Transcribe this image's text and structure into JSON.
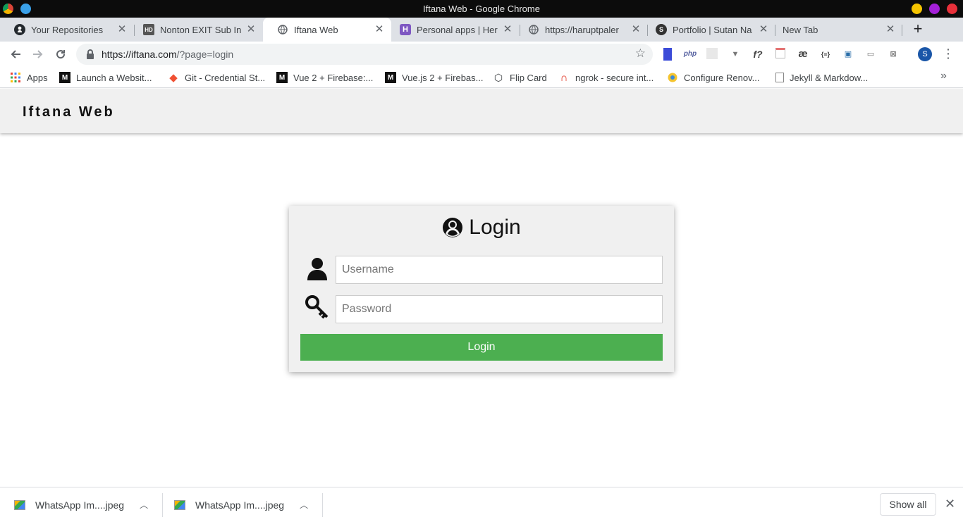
{
  "window": {
    "title": "Iftana Web - Google Chrome"
  },
  "tabs": [
    {
      "label": "Your Repositories",
      "icon": "github-icon"
    },
    {
      "label": "Nonton EXIT Sub In",
      "icon": "hd-icon"
    },
    {
      "label": "Iftana Web",
      "icon": "globe-icon",
      "active": true
    },
    {
      "label": "Personal apps | Her",
      "icon": "heroku-icon"
    },
    {
      "label": "https://haruptpaler",
      "icon": "globe-icon"
    },
    {
      "label": "Portfolio | Sutan Na",
      "icon": "s-icon"
    },
    {
      "label": "New Tab",
      "icon": ""
    }
  ],
  "toolbar": {
    "url_host": "https://iftana.com",
    "url_path": "/?page=login",
    "extensions": [
      "flag",
      "php",
      "ext",
      "v",
      "f?",
      "cal",
      "æ",
      "{≡}",
      "box",
      "chat",
      "x"
    ],
    "profile_initial": "S"
  },
  "bookmarks": [
    {
      "label": "Apps",
      "icon": "apps-grid-icon"
    },
    {
      "label": "Launch a Websit...",
      "icon": "medium-icon"
    },
    {
      "label": "Git - Credential St...",
      "icon": "git-icon"
    },
    {
      "label": "Vue 2 + Firebase:...",
      "icon": "medium-icon"
    },
    {
      "label": "Vue.js 2 + Firebas...",
      "icon": "medium-icon"
    },
    {
      "label": "Flip Card",
      "icon": "codepen-icon"
    },
    {
      "label": "ngrok - secure int...",
      "icon": "ngrok-icon"
    },
    {
      "label": "Configure Renov...",
      "icon": "renovate-icon"
    },
    {
      "label": "Jekyll & Markdow...",
      "icon": "page-icon"
    }
  ],
  "page": {
    "site_title": "Iftana Web",
    "login": {
      "title": "Login",
      "username_placeholder": "Username",
      "password_placeholder": "Password",
      "submit_label": "Login",
      "button_color": "#4caf50"
    }
  },
  "downloads": {
    "items": [
      {
        "label": "WhatsApp Im....jpeg"
      },
      {
        "label": "WhatsApp Im....jpeg"
      }
    ],
    "show_all_label": "Show all"
  }
}
